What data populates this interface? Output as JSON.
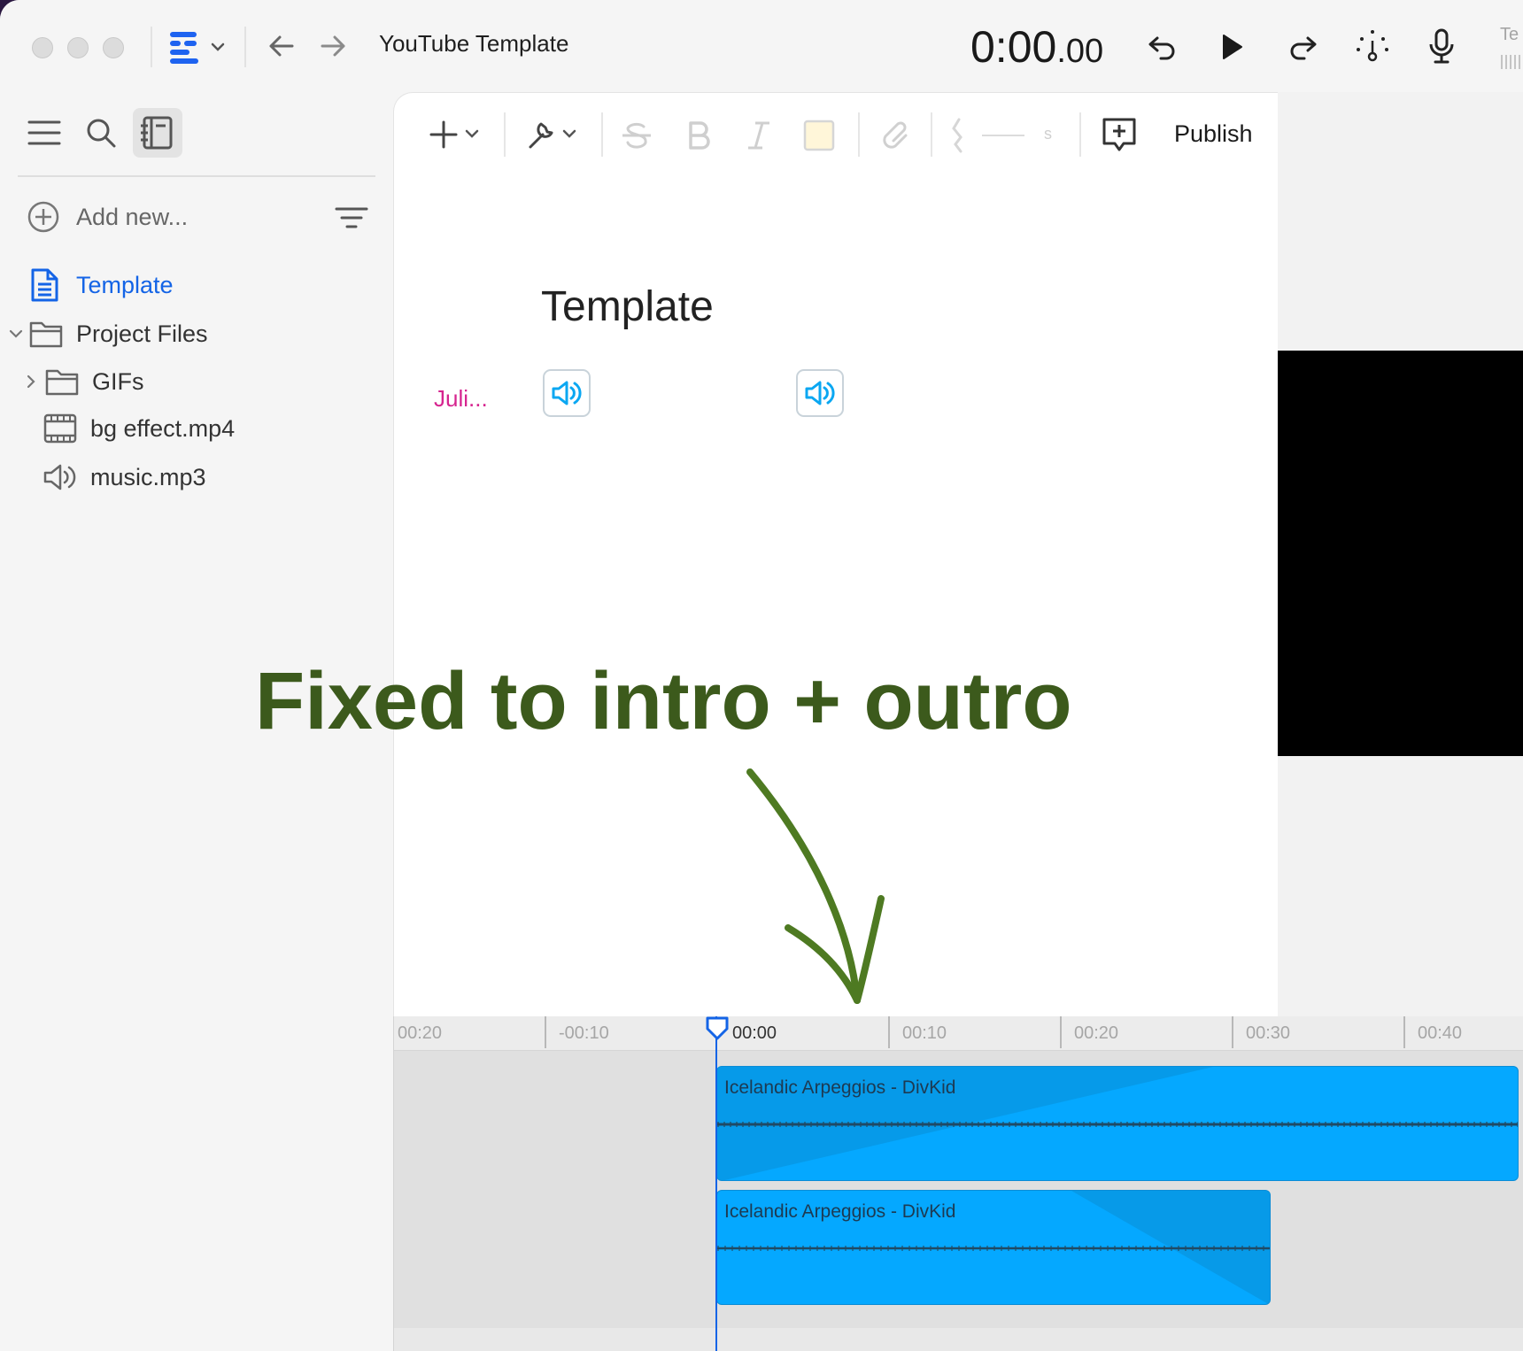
{
  "window": {
    "title": "YouTube Template",
    "timecode": {
      "main": "0:00",
      "fraction": ".00"
    },
    "clipped_label": "Te"
  },
  "sidebar": {
    "add_new_label": "Add new...",
    "items": [
      {
        "label": "Template",
        "icon": "document-icon",
        "active": true
      },
      {
        "label": "Project Files",
        "icon": "folder-icon",
        "expanded": true
      },
      {
        "label": "GIFs",
        "icon": "folder-icon",
        "expanded": false
      },
      {
        "label": "bg effect.mp4",
        "icon": "film-icon"
      },
      {
        "label": "music.mp3",
        "icon": "speaker-icon"
      }
    ]
  },
  "editor": {
    "toolbar": {
      "publish_label": "Publish",
      "gap_unit": "s"
    },
    "heading": "Template",
    "speaker": "Juli..."
  },
  "timeline": {
    "ticks": [
      "00:20",
      "-00:10",
      "00:00",
      "00:10",
      "00:20",
      "00:30",
      "00:40"
    ],
    "clips": [
      {
        "title": "Icelandic Arpeggios - DivKid"
      },
      {
        "title": "Icelandic Arpeggios - DivKid"
      }
    ]
  },
  "annotation": {
    "text": "Fixed to intro + outro"
  },
  "colors": {
    "accent": "#1464e6",
    "speaker": "#d6248f",
    "clip": "#05a8ff",
    "annotation": "#3c5a1c"
  }
}
